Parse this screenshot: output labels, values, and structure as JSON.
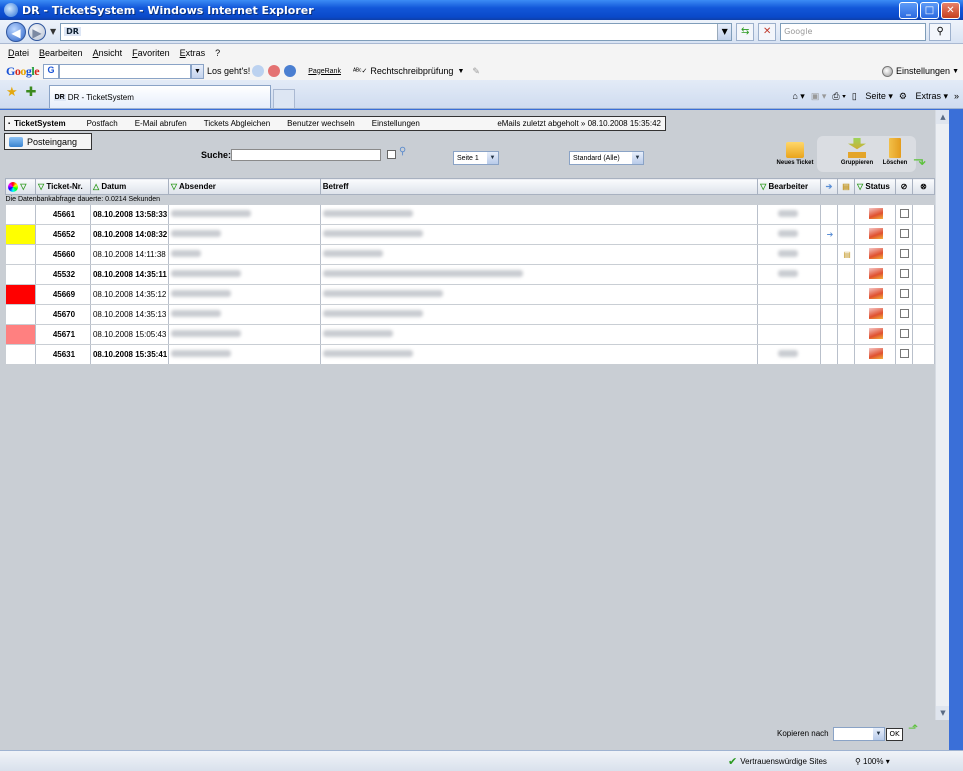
{
  "window": {
    "title": "DR - TicketSystem - Windows Internet Explorer",
    "min": "_",
    "max": "□",
    "close": "✕"
  },
  "address": {
    "favicon": "DR",
    "url": "",
    "search_placeholder": "Google"
  },
  "menu": [
    "Datei",
    "Bearbeiten",
    "Ansicht",
    "Favoriten",
    "Extras",
    "?"
  ],
  "google_toolbar": {
    "go_label": "Los geht's!",
    "pagerank": "PageRank",
    "spellcheck": "Rechtschreibprüfung",
    "settings": "Einstellungen"
  },
  "tabbar": {
    "tab_title": "DR - TicketSystem",
    "tab_favicon": "DR",
    "page_cmd": "Seite",
    "extras_cmd": "Extras"
  },
  "app": {
    "nav": [
      "TicketSystem",
      "Postfach",
      "E-Mail abrufen",
      "Tickets Abgleichen",
      "Benutzer wechseln",
      "Einstellungen"
    ],
    "last_mail": "eMails zuletzt abgeholt » 08.10.2008 15:35:42",
    "inbox_label": "Posteingang",
    "search_label": "Suche:",
    "page_select": "Seite 1",
    "filter_select": "Standard (Alle)",
    "actions": {
      "new_ticket": "Neues Ticket",
      "group": "Gruppieren",
      "delete": "Löschen"
    },
    "db_info": "Die Datenbankabfrage dauerte: 0.0214 Sekunden",
    "copy_label": "Kopieren nach",
    "ok_label": "OK"
  },
  "table": {
    "columns": {
      "ticket": "Ticket-Nr.",
      "date": "Datum",
      "sender": "Absender",
      "subject": "Betreff",
      "assignee": "Bearbeiter",
      "status": "Status"
    },
    "rows": [
      {
        "color": "#ffffff",
        "id": "45661",
        "date": "08.10.2008 13:58:33",
        "bold": true,
        "attach": false,
        "note": false
      },
      {
        "color": "#ffff00",
        "id": "45652",
        "date": "08.10.2008 14:08:32",
        "bold": true,
        "attach": true,
        "note": false
      },
      {
        "color": "#ffffff",
        "id": "45660",
        "date": "08.10.2008 14:11:38",
        "bold": false,
        "attach": false,
        "note": true
      },
      {
        "color": "#ffffff",
        "id": "45532",
        "date": "08.10.2008 14:35:11",
        "bold": true,
        "attach": false,
        "note": false
      },
      {
        "color": "#ff0000",
        "id": "45669",
        "date": "08.10.2008 14:35:12",
        "bold": false,
        "attach": false,
        "note": false
      },
      {
        "color": "#ffffff",
        "id": "45670",
        "date": "08.10.2008 14:35:13",
        "bold": false,
        "attach": false,
        "note": false
      },
      {
        "color": "#ff8080",
        "id": "45671",
        "date": "08.10.2008 15:05:43",
        "bold": false,
        "attach": false,
        "note": false
      },
      {
        "color": "#ffffff",
        "id": "45631",
        "date": "08.10.2008 15:35:41",
        "bold": true,
        "attach": false,
        "note": false
      }
    ]
  },
  "status_bar": {
    "trusted": "Vertrauenswürdige Sites",
    "zoom": "100%"
  }
}
